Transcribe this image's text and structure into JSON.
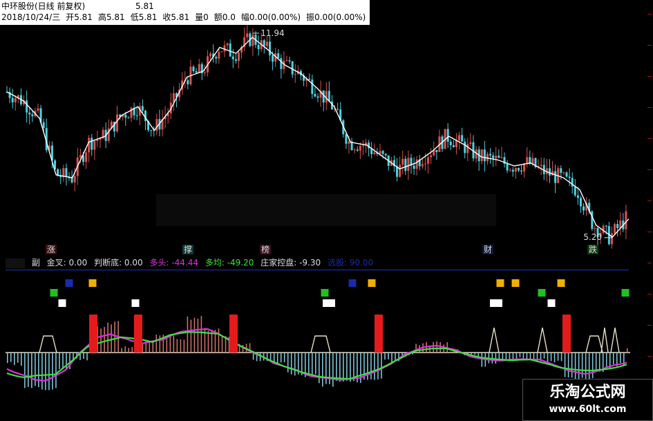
{
  "header": {
    "stock": "中环股份(日线 前复权)",
    "date": "2018/10/24/三",
    "open": "开5.81",
    "high": "高5.81",
    "low": "低5.81",
    "close": "收5.81",
    "volume": "量0",
    "amount": "额0.0",
    "change": "幅0.00(0.00%)",
    "amplitude": "振0.00(0.00%)",
    "ma_value": "5.81"
  },
  "price_labels": {
    "high": "11.94",
    "low": "5.20"
  },
  "events": [
    {
      "label": "涨",
      "color": "#c0392b"
    },
    {
      "label": "撑",
      "color": "#2aa0a0"
    },
    {
      "label": "榜",
      "color": "#b03050"
    },
    {
      "label": "财",
      "color": "#3a5fcd"
    },
    {
      "label": "跌",
      "color": "#2f9e2f"
    }
  ],
  "sub_indicator": {
    "name": "副",
    "golden_cross": "金叉: 0.00",
    "judge_bottom": "判断底: 0.00",
    "long": "多头: -44.44",
    "long_avg": "多均: -49.20",
    "dealer": "庄家控盘: -9.30",
    "select": "选股: 90.00"
  },
  "colors": {
    "up": "#d9534f",
    "down": "#4fd1e0",
    "ma_white": "#ffffff",
    "purple_line": "#e030e0",
    "green_line": "#40e040",
    "marker_red": "#e51b1b",
    "marker_yellow": "#f0b000",
    "marker_green": "#20c020",
    "marker_blue": "#1a2aa8",
    "marker_white": "#ffffff"
  },
  "watermark": {
    "title": "乐淘公式网",
    "url": "www.60lt.com"
  },
  "chart_data": {
    "type": "line",
    "title": "中环股份(日线 前复权)",
    "series": [
      {
        "name": "",
        "values": [
          10.1,
          9.8,
          9.2,
          7.3,
          7.2,
          8.4,
          8.6,
          9.3,
          9.6,
          8.8,
          9.5,
          10.6,
          10.8,
          11.6,
          11.4,
          11.94,
          11.5,
          11.0,
          10.7,
          10.2,
          9.6,
          8.4,
          8.3,
          7.9,
          7.5,
          7.7,
          8.1,
          8.6,
          8.3,
          7.9,
          7.8,
          7.6,
          7.7,
          7.4,
          7.2,
          6.8,
          5.6,
          5.2,
          5.81
        ]
      }
    ],
    "annotations": [
      "11.94",
      "5.20"
    ]
  }
}
